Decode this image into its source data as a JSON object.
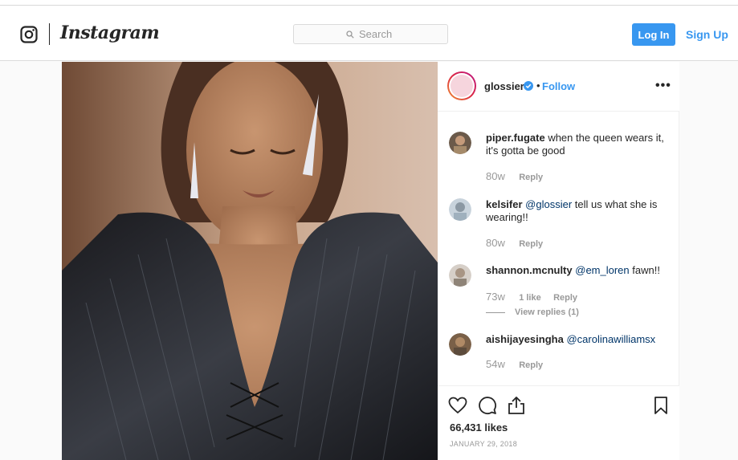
{
  "header": {
    "brand": "Instagram",
    "search_placeholder": "Search",
    "login_label": "Log In",
    "signup_label": "Sign Up",
    "accent_color": "#3897f0"
  },
  "post": {
    "owner": "glossier",
    "verified": true,
    "separator": "•",
    "follow_label": "Follow",
    "more_icon": "more-options-icon",
    "likes_text": "66,431 likes",
    "date": "JANUARY 29, 2018"
  },
  "comments": [
    {
      "user": "piper.fugate",
      "mention": "",
      "text": "when the queen wears it, it's gotta be good",
      "age": "80w",
      "likes": "",
      "reply": "Reply"
    },
    {
      "user": "kelsifer",
      "mention": "@glossier",
      "text": "tell us what she is wearing!!",
      "age": "80w",
      "likes": "",
      "reply": "Reply"
    },
    {
      "user": "shannon.mcnulty",
      "mention": "@em_loren",
      "text": "fawn!!",
      "age": "73w",
      "likes": "1 like",
      "reply": "Reply",
      "view_replies": "View replies (1)"
    },
    {
      "user": "aishijayesingha",
      "mention": "@carolinawilliamsx",
      "text": "",
      "age": "54w",
      "likes": "",
      "reply": "Reply"
    }
  ],
  "actions": {
    "icons": [
      "heart-icon",
      "comment-icon",
      "share-icon",
      "bookmark-icon"
    ]
  }
}
